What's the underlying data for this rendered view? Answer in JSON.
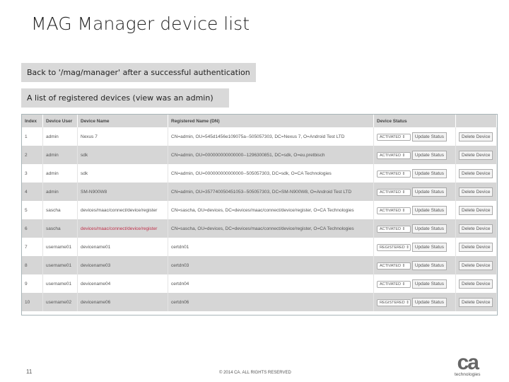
{
  "title": "MAG Manager device list",
  "note1": "Back to '/mag/manager' after a successful authentication",
  "note2": "A list of registered devices (view was an admin)",
  "table": {
    "headers": [
      "Index",
      "Device User",
      "Device Name",
      "Registered Name (DN)",
      "Device Status",
      ""
    ],
    "update_label": "Update Status",
    "delete_label": "Delete Device",
    "rows": [
      {
        "index": "1",
        "user": "admin",
        "name": "Nexus 7",
        "dn": "CN=admin, OU=545d1456e109075a--505057303, DC=Nexus 7, O=Android Test LTD",
        "status": "ACTIVATED"
      },
      {
        "index": "2",
        "user": "admin",
        "name": "sdk",
        "dn": "CN=admin, OU=000000000000000--1296300851, DC=sdk, O=eu.pretbisch",
        "status": "ACTIVATED"
      },
      {
        "index": "3",
        "user": "admin",
        "name": "sdk",
        "dn": "CN=admin, OU=000000000000000--505057303, DC=sdk, O=CA Technologies",
        "status": "ACTIVATED"
      },
      {
        "index": "4",
        "user": "admin",
        "name": "SM-N900W8",
        "dn": "CN=admin, OU=357740050451053--505057303, DC=SM-N900W8, O=Android Test LTD",
        "status": "ACTIVATED"
      },
      {
        "index": "5",
        "user": "sascha",
        "name": "devices/maac/connect/device/register",
        "dn": "CN=sascha, OU=devices, DC=devices/maac/connect/device/register, O=CA Technologies",
        "status": "ACTIVATED"
      },
      {
        "index": "6",
        "user": "sascha",
        "name": "devices/maac/connect/device/register",
        "dn": "CN=sascha, OU=devices, DC=devices/maac/connect/device/register, O=CA Technologies",
        "status": "ACTIVATED"
      },
      {
        "index": "7",
        "user": "username01",
        "name": "devicename01",
        "dn": "certdn01",
        "status": "REGISTERED"
      },
      {
        "index": "8",
        "user": "username01",
        "name": "devicename03",
        "dn": "certdn03",
        "status": "ACTIVATED"
      },
      {
        "index": "9",
        "user": "username01",
        "name": "devicename04",
        "dn": "certdn04",
        "status": "ACTIVATED"
      },
      {
        "index": "10",
        "user": "username02",
        "name": "devicename06",
        "dn": "certdn06",
        "status": "REGISTERED"
      }
    ]
  },
  "footer": {
    "page": "11",
    "copyright": "© 2014 CA. ALL RIGHTS RESERVED",
    "logo_mark": "ca",
    "logo_text": "technologies"
  }
}
